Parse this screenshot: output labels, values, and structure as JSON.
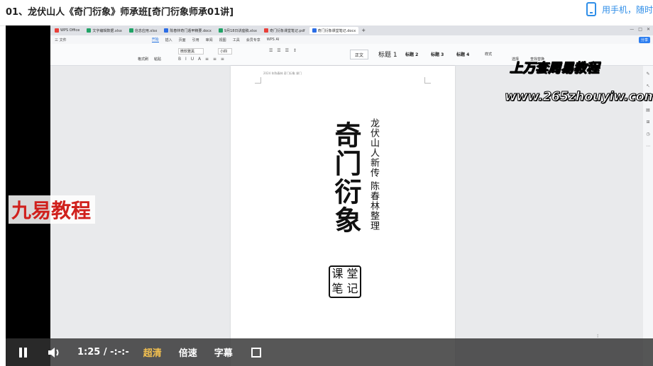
{
  "page": {
    "title": "01、龙伏山人《奇门衍象》师承班[奇门衍象师承01讲]",
    "phone_link": "用手机，随时"
  },
  "wps": {
    "tabs": [
      {
        "label": "WPS Office",
        "color": "#e9403a"
      },
      {
        "label": "文字编辑数据.xlsx",
        "color": "#21a366"
      },
      {
        "label": "信息应用.xlsx",
        "color": "#21a366"
      },
      {
        "label": "陈春林奇门遁甲精要.docx",
        "color": "#2b6de6"
      },
      {
        "label": "9月18日讲座稿.xlsx",
        "color": "#21a366"
      },
      {
        "label": "奇门衍象课堂笔记.pdf",
        "color": "#e9403a"
      },
      {
        "label": "奇门衍象课堂笔记.docx",
        "color": "#2b6de6"
      }
    ],
    "menu": {
      "file": "三 文件",
      "items": [
        "开始",
        "插入",
        "页面",
        "引用",
        "审阅",
        "视图",
        "工具",
        "会员专享",
        "WPS AI"
      ],
      "share": "分享"
    },
    "ribbon": {
      "format_painter": "格式刷",
      "paste": "粘贴",
      "font_name": "微软雅黑",
      "font_size": "小四",
      "styles": [
        "正文",
        "标题 1",
        "标题 2",
        "标题 3",
        "标题 4",
        "样式"
      ],
      "find": "查找替换",
      "select": "选择"
    },
    "doc": {
      "header": "2024 年陈春林 奇门衍象 课门",
      "title": "奇门衍象",
      "subtitle": "龙伏山人新传  陈春林整理",
      "seal": [
        "堂",
        "课",
        "记",
        "笔"
      ]
    }
  },
  "watermarks": {
    "line1": "上万套周易教程",
    "line2": "www.265zhouyiw.com",
    "brand": "九易教程"
  },
  "player": {
    "time": "1:25 / -:-:-",
    "quality": "超清",
    "speed": "倍速",
    "subtitles": "字幕"
  }
}
